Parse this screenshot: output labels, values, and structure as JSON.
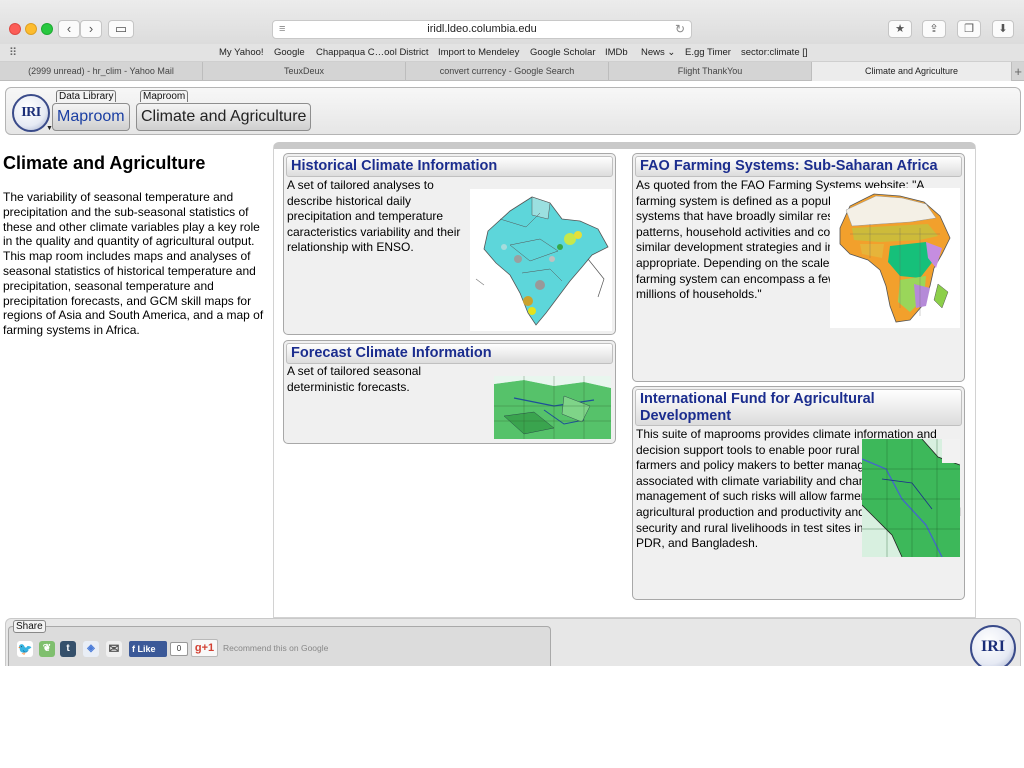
{
  "browser": {
    "url": "iridl.ldeo.columbia.edu",
    "bookmarks": [
      "My Yahoo!",
      "Google",
      "Chappaqua C…ool District",
      "Import to Mendeley",
      "Google Scholar",
      "IMDb",
      "News ⌄",
      "E.gg Timer",
      "sector:climate []"
    ],
    "tabs": [
      {
        "label": "(2999 unread) - hr_clim - Yahoo Mail",
        "active": false
      },
      {
        "label": "TeuxDeux",
        "active": false
      },
      {
        "label": "convert currency - Google Search",
        "active": false
      },
      {
        "label": "Flight ThankYou",
        "active": false
      },
      {
        "label": "Climate and Agriculture",
        "active": true
      }
    ]
  },
  "header": {
    "logo_text": "IRI",
    "crumbs": [
      {
        "label": "Data Library",
        "button": "Maproom"
      },
      {
        "label": "Maproom",
        "button": "Climate and Agriculture"
      }
    ]
  },
  "intro": {
    "title": "Climate and Agriculture",
    "text": "The variability of seasonal temperature and precipitation and the sub-seasonal statistics of these and other climate variables play a key role in the quality and quantity of agricultural output. This map room includes maps and analyses of seasonal statistics of historical temperature and precipitation, seasonal temperature and precipitation forecasts, and GCM skill maps for regions of Asia and South America, and a map of farming systems in Africa."
  },
  "cards": {
    "historical": {
      "title": "Historical Climate Information",
      "text": "A set of tailored analyses to describe historical daily precipitation and temperature caracteristics variability and their relationship with ENSO."
    },
    "forecast": {
      "title": "Forecast Climate Information",
      "text": "A set of tailored seasonal deterministic forecasts."
    },
    "fao": {
      "title": "FAO Farming Systems: Sub-Saharan Africa",
      "text": "As quoted from the FAO Farming Systems website: \"A farming system is defined as a population of individual farm systems that have broadly similar resource bases, enterprise patterns, household activities and constraints, and for which similar development strategies and interventions would be appropriate. Depending on the scale of the analysis, a farming system can encompass a few dozen or many millions of households.\""
    },
    "ifad": {
      "title": "International Fund for Agricultural Development",
      "text": "This suite of maprooms provides climate information and decision support tools to enable poor rural women and men farmers and policy makers to better manage the risks associated with climate variability and change. Better management of such risks will allow farmers to increase agricultural production and productivity and will enhance food security and rural livelihoods in test sites in Indonesia, Lao PDR, and Bangladesh."
    }
  },
  "share": {
    "label": "Share",
    "like_label": "Like",
    "like_count": "0",
    "gplus_label": "g+1",
    "recommend_text": "Recommend this on Google",
    "icons": [
      "twitter-icon",
      "evernote-icon",
      "tumblr-icon",
      "delicious-icon",
      "email-icon"
    ]
  },
  "footer": {
    "logo_text": "IRI"
  }
}
